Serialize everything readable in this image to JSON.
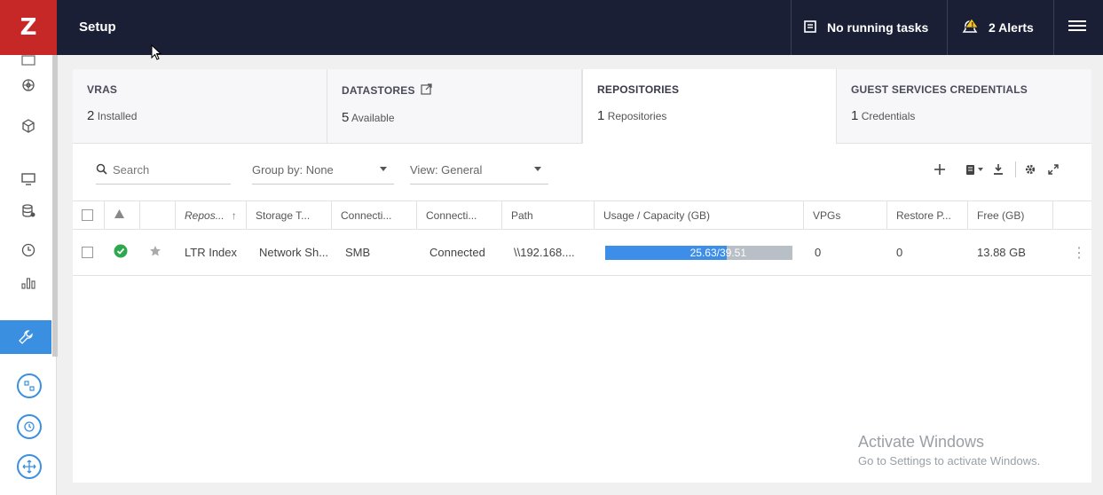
{
  "app": {
    "logo": "Z",
    "title": "Setup"
  },
  "topbar": {
    "tasks_label": "No running tasks",
    "alerts_label": "2 Alerts"
  },
  "sidebar": {
    "icons": [
      "mail-icon",
      "network-icon",
      "cube-icon",
      "monitor-icon",
      "database-icon",
      "clock-icon",
      "bar-chart-icon",
      "wrench-icon",
      "restore-icon",
      "history-icon",
      "move-icon"
    ],
    "active_item": "wrench-icon"
  },
  "tabs": [
    {
      "title": "VRAS",
      "count": "2",
      "unit": "Installed"
    },
    {
      "title": "DATASTORES",
      "count": "5",
      "unit": "Available"
    },
    {
      "title": "REPOSITORIES",
      "count": "1",
      "unit": "Repositories"
    },
    {
      "title": "GUEST SERVICES CREDENTIALS",
      "count": "1",
      "unit": "Credentials"
    }
  ],
  "toolbar": {
    "search_placeholder": "Search",
    "group_by": "Group by: None",
    "view": "View: General"
  },
  "grid": {
    "columns": [
      "Repos...",
      "Storage T...",
      "Connecti...",
      "Connecti...",
      "Path",
      "Usage / Capacity (GB)",
      "VPGs",
      "Restore P...",
      "Free (GB)"
    ],
    "rows": [
      {
        "status": "ok",
        "name": "LTR Index",
        "storage_type": "Network Sh...",
        "connection_type": "SMB",
        "connection_status": "Connected",
        "path": "\\\\192.168....",
        "usage_label": "25.63/39.51",
        "usage_fraction": 0.6487,
        "vpgs": "0",
        "restore_points": "0",
        "free": "13.88 GB"
      }
    ]
  },
  "watermark": {
    "title": "Activate Windows",
    "subtitle": "Go to Settings to activate Windows."
  },
  "colors": {
    "topbar": "#1b1f35",
    "logo": "#c62828",
    "accent": "#3a8fe0",
    "usage_fill": "#3c8ee8",
    "status_ok": "#2ea84f"
  }
}
